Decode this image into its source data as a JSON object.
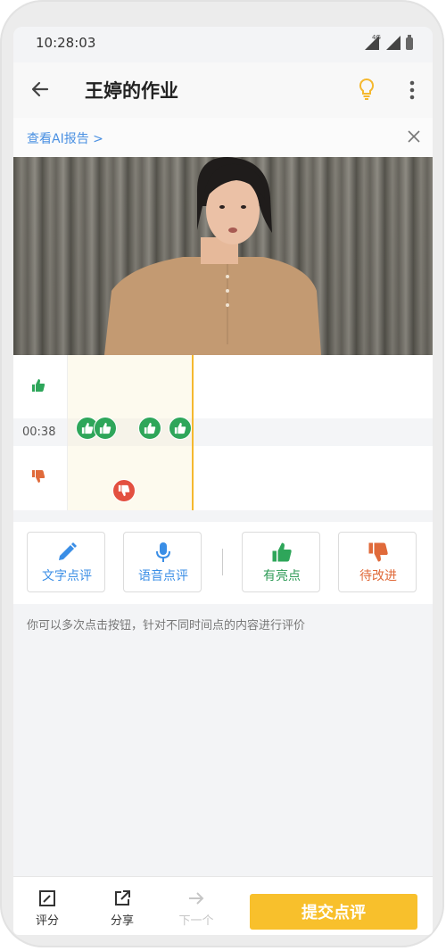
{
  "status_bar": {
    "time": "10:28:03",
    "network": "4G"
  },
  "header": {
    "title": "王婷的作业"
  },
  "ai_report": {
    "link": "查看AI报告 >"
  },
  "timeline": {
    "current_time": "00:38",
    "highlight_marks": 4,
    "improve_marks": 1
  },
  "actions": {
    "text_comment": "文字点评",
    "voice_comment": "语音点评",
    "highlight": "有亮点",
    "improve": "待改进"
  },
  "hint": "你可以多次点击按钮，针对不同时间点的内容进行评价",
  "bottom_bar": {
    "score": "评分",
    "share": "分享",
    "next": "下一个",
    "submit": "提交点评"
  },
  "colors": {
    "accent": "#f8c02c",
    "link": "#4a90e2",
    "positive": "#2ea65a",
    "negative": "#e35040",
    "improve_text": "#e06a3a"
  },
  "icons": [
    "back-arrow-icon",
    "lightbulb-icon",
    "more-vert-icon",
    "close-icon",
    "thumbs-up-icon",
    "thumbs-down-icon",
    "pencil-icon",
    "microphone-icon",
    "score-icon",
    "share-icon",
    "next-arrow-icon"
  ]
}
